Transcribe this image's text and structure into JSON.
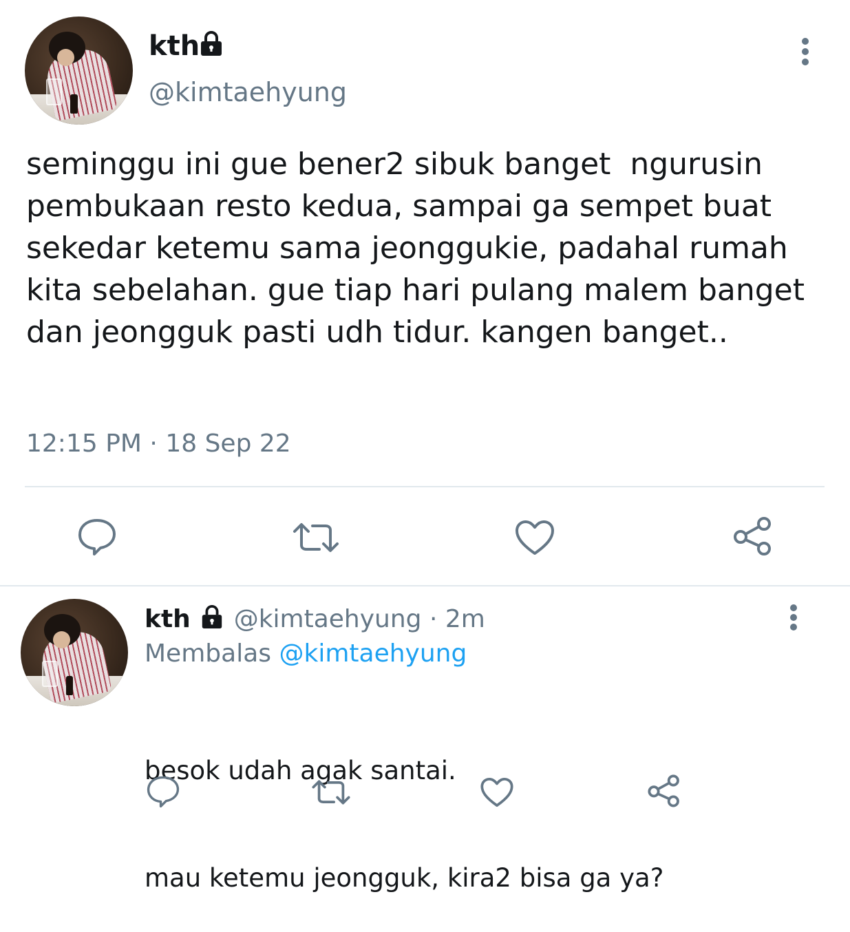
{
  "main_tweet": {
    "author": {
      "display_name": "kth",
      "handle": "@kimtaehyung",
      "protected_icon": "lock-icon"
    },
    "text": "seminggu ini gue bener2 sibuk banget  ngurusin pembukaan resto kedua, sampai ga sempet buat sekedar ketemu sama jeonggukie, padahal rumah kita sebelahan. gue tiap hari pulang malem banget dan jeongguk pasti udh tidur. kangen banget..",
    "time": "12:15 PM",
    "separator": "·",
    "date": "18 Sep 22",
    "actions": [
      "reply-icon",
      "retweet-icon",
      "like-icon",
      "share-icon"
    ]
  },
  "reply_tweet": {
    "author": {
      "display_name": "kth",
      "handle": "@kimtaehyung",
      "protected_icon": "lock-icon"
    },
    "separator": "·",
    "age": "2m",
    "replying_label": "Membalas",
    "replying_to": "@kimtaehyung",
    "text_line1": "besok udah agak santai.",
    "text_line2": "mau ketemu jeongguk, kira2 bisa ga ya?",
    "actions": [
      "reply-icon",
      "retweet-icon",
      "like-icon",
      "share-icon"
    ]
  },
  "colors": {
    "text": "#14171a",
    "secondary": "#657786",
    "link": "#1da1f2",
    "divider": "#e1e8ed"
  }
}
